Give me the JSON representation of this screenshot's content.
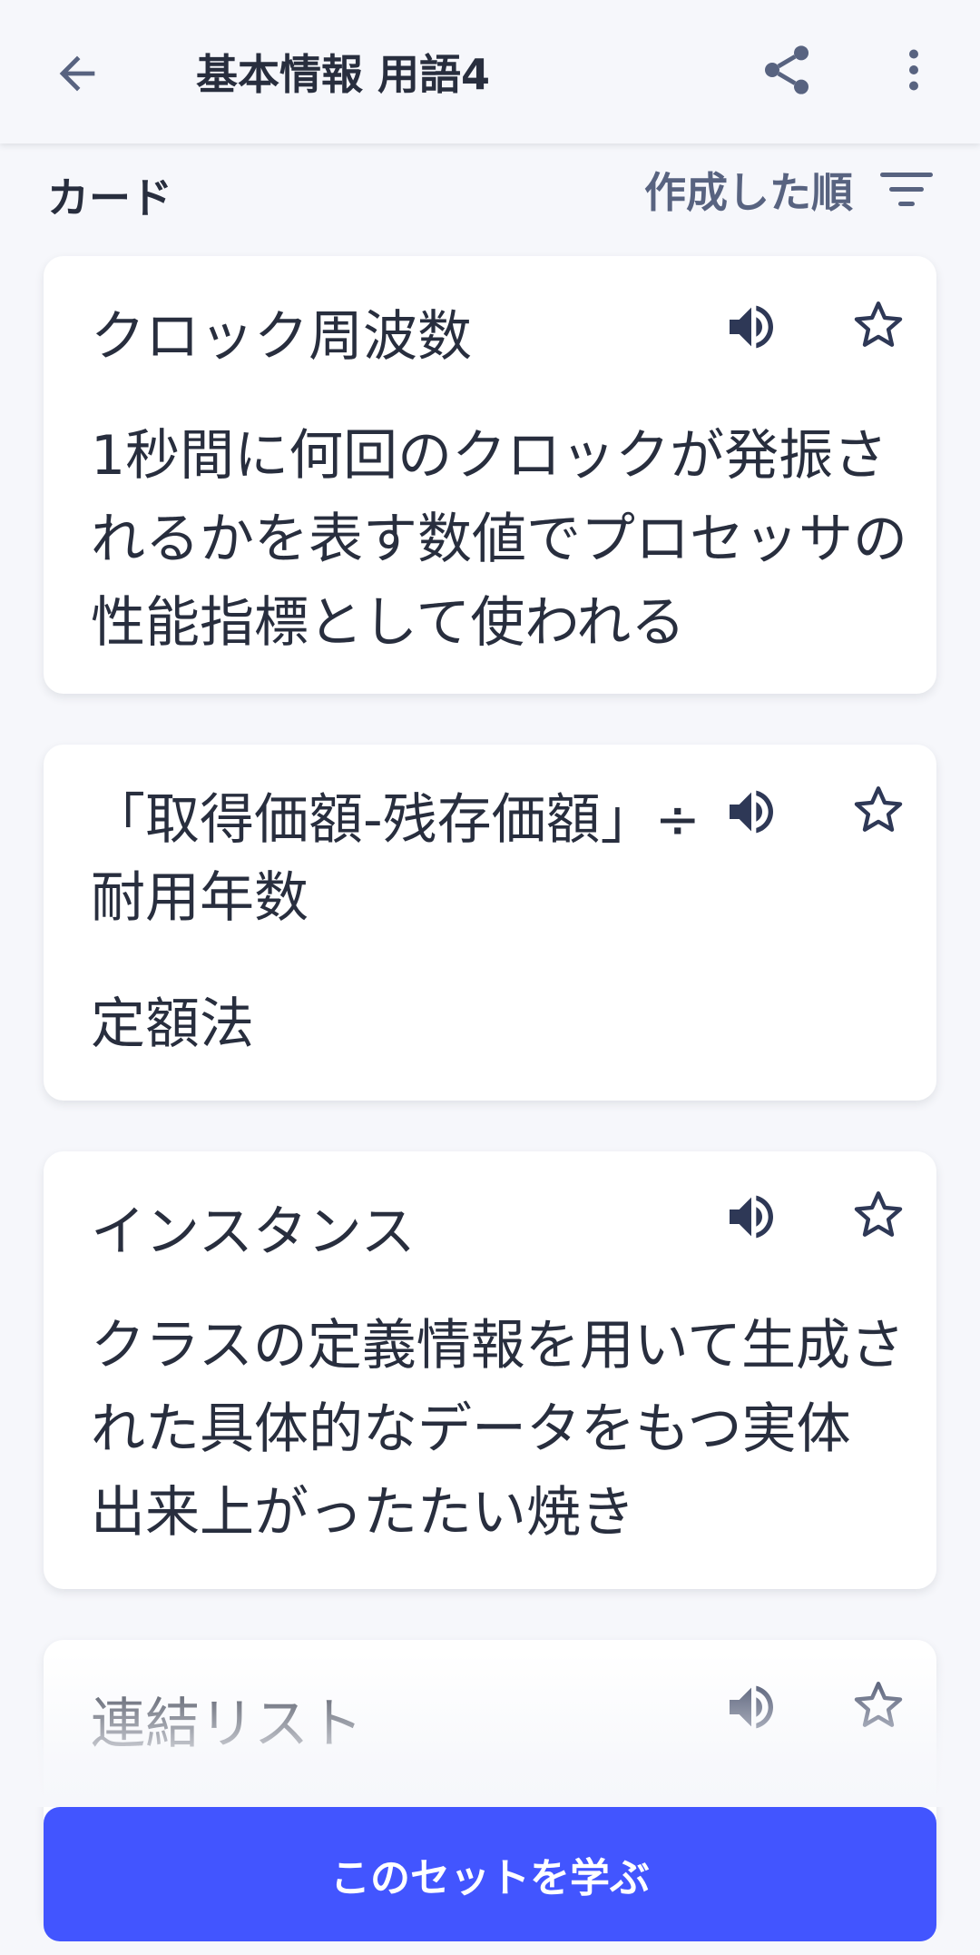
{
  "header": {
    "title": "基本情報 用語4",
    "icons": {
      "back": "arrow-left-icon",
      "share": "share-icon",
      "more": "more-vertical-icon"
    }
  },
  "section": {
    "label": "カード",
    "sort_label": "作成した順",
    "sort_icon": "filter-lines-icon"
  },
  "cards": [
    {
      "term": "クロック周波数",
      "definition": "1秒間に何回のクロックが発振されるかを表す数値でプロセッサの性能指標として使われる"
    },
    {
      "term": "「取得価額-残存価額」÷耐用年数",
      "definition": "定額法"
    },
    {
      "term": "インスタンス",
      "definition": "クラスの定義情報を用いて生成された具体的なデータをもつ実体 出来上がったたい焼き"
    },
    {
      "term": "連結リスト",
      "definition": ""
    }
  ],
  "footer": {
    "cta_label": "このセットを学ぶ"
  },
  "colors": {
    "background": "#f6f7fb",
    "card": "#ffffff",
    "text": "#282e3e",
    "muted": "#586380",
    "accent": "#4255ff"
  }
}
